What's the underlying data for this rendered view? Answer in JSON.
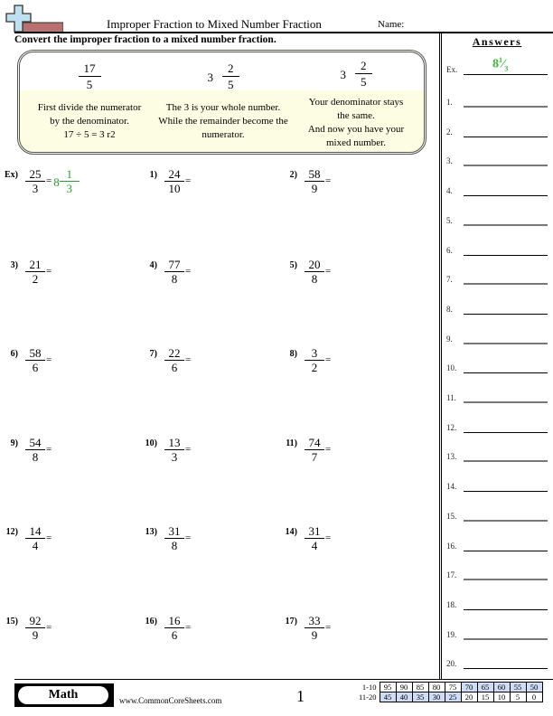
{
  "header": {
    "logo_icon": "plus-sign-logo",
    "title": "Improper Fraction to Mixed Number Fraction",
    "name_label": "Name:"
  },
  "instructions": "Convert the improper fraction to a mixed number fraction.",
  "example_box": {
    "steps": [
      {
        "whole": "",
        "numerator": "17",
        "denominator": "5",
        "text": [
          "First divide the numerator",
          "by the denominator.",
          "17 ÷ 5 = 3 r2"
        ]
      },
      {
        "whole": "3",
        "numerator": "2",
        "denominator": "5",
        "text": [
          "The 3 is your whole number.",
          "While the remainder become the",
          "numerator."
        ]
      },
      {
        "whole": "3",
        "numerator": "2",
        "denominator": "5",
        "text": [
          "Your denominator stays",
          "the same.",
          "And now you have your",
          "mixed number."
        ]
      }
    ]
  },
  "example_problem": {
    "label": "Ex)",
    "numerator": "25",
    "denominator": "3",
    "equals": "=",
    "answer": {
      "whole": "8",
      "numerator": "1",
      "denominator": "3"
    }
  },
  "problems": [
    {
      "label": "1)",
      "numerator": "24",
      "denominator": "10"
    },
    {
      "label": "2)",
      "numerator": "58",
      "denominator": "9"
    },
    {
      "label": "3)",
      "numerator": "21",
      "denominator": "2"
    },
    {
      "label": "4)",
      "numerator": "77",
      "denominator": "8"
    },
    {
      "label": "5)",
      "numerator": "20",
      "denominator": "8"
    },
    {
      "label": "6)",
      "numerator": "58",
      "denominator": "6"
    },
    {
      "label": "7)",
      "numerator": "22",
      "denominator": "6"
    },
    {
      "label": "8)",
      "numerator": "3",
      "denominator": "2"
    },
    {
      "label": "9)",
      "numerator": "54",
      "denominator": "8"
    },
    {
      "label": "10)",
      "numerator": "13",
      "denominator": "3"
    },
    {
      "label": "11)",
      "numerator": "74",
      "denominator": "7"
    },
    {
      "label": "12)",
      "numerator": "14",
      "denominator": "4"
    },
    {
      "label": "13)",
      "numerator": "31",
      "denominator": "8"
    },
    {
      "label": "14)",
      "numerator": "31",
      "denominator": "4"
    },
    {
      "label": "15)",
      "numerator": "92",
      "denominator": "9"
    },
    {
      "label": "16)",
      "numerator": "16",
      "denominator": "6"
    },
    {
      "label": "17)",
      "numerator": "33",
      "denominator": "9"
    }
  ],
  "equals_sign": "=",
  "answers": {
    "title": "Answers",
    "example_label": "Ex.",
    "example_value": {
      "whole": "8",
      "numerator": "1",
      "denominator": "3"
    },
    "rows": [
      "1.",
      "2.",
      "3.",
      "4.",
      "5.",
      "6.",
      "7.",
      "8.",
      "9.",
      "10.",
      "11.",
      "12.",
      "13.",
      "14.",
      "15.",
      "16.",
      "17.",
      "18.",
      "19.",
      "20."
    ]
  },
  "footer": {
    "subject": "Math",
    "website": "www.CommonCoreSheets.com",
    "page_number": "1",
    "score_table": [
      {
        "range": "1-10",
        "scores": [
          "95",
          "90",
          "85",
          "80",
          "75",
          "70",
          "65",
          "60",
          "55",
          "50"
        ]
      },
      {
        "range": "11-20",
        "scores": [
          "45",
          "40",
          "35",
          "30",
          "25",
          "20",
          "15",
          "10",
          "5",
          "0"
        ]
      }
    ]
  },
  "colors": {
    "answer_green": "#2e9a2e",
    "example_box_fill": "#fdfde4",
    "score_highlight": "#cfdcf5"
  }
}
